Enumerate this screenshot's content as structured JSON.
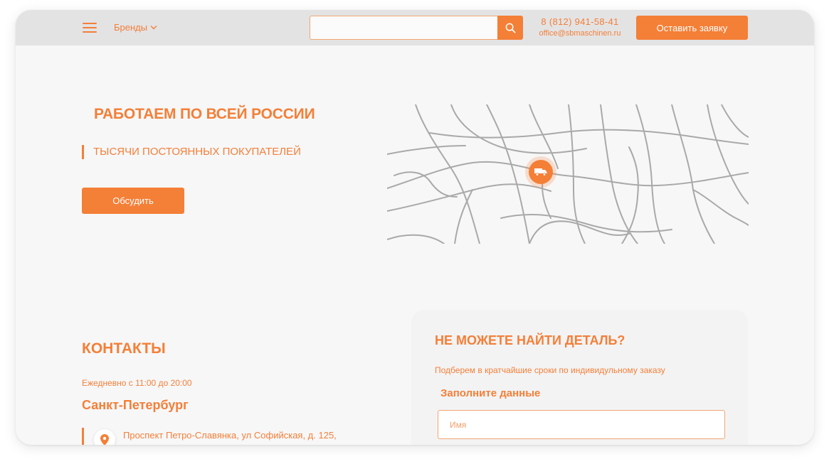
{
  "header": {
    "brands_label": "Бренды",
    "search_placeholder": "",
    "phone": "8 (812) 941-58-41",
    "email": "office@sbmaschinen.ru",
    "request_button": "Оставить заявку"
  },
  "hero": {
    "title": "РАБОТАЕМ ПО ВСЕЙ РОССИИ",
    "subtitle": "ТЫСЯЧИ ПОСТОЯННЫХ ПОКУПАТЕЛЕЙ",
    "discuss_button": "Обсудить"
  },
  "contacts": {
    "title": "КОНТАКТЫ",
    "hours": "Ежедневно с 11:00 до 20:00",
    "city": "Санкт-Петербург",
    "address": "Проспект Петро-Славянка, ул Софийская, д. 125,"
  },
  "form": {
    "title": "НЕ МОЖЕТЕ НАЙТИ ДЕТАЛЬ?",
    "subtitle": "Подберем в кратчайшие сроки по индивидульному заказу",
    "label": "Заполните данные",
    "name_placeholder": "Имя"
  },
  "colors": {
    "accent": "#f47f37",
    "header_bg": "#e3e3e4",
    "page_bg": "#f7f7f8",
    "map_lines": "#a9a9a9"
  },
  "icons": {
    "menu": "hamburger-icon",
    "brands_toggle": "chevron-down-icon",
    "search": "search-icon",
    "map_marker": "truck-icon",
    "address_marker": "location-pin-icon"
  }
}
